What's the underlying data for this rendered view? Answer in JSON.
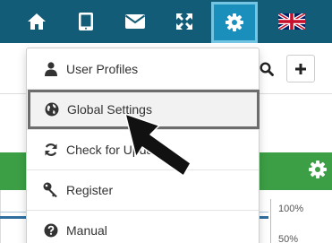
{
  "nav": {
    "buttons": [
      {
        "icon": "home-icon",
        "active": false
      },
      {
        "icon": "tablet-icon",
        "active": false
      },
      {
        "icon": "envelope-icon",
        "active": false
      },
      {
        "icon": "expand-arrows-icon",
        "active": false
      },
      {
        "icon": "gear-icon",
        "active": true
      },
      {
        "icon": "uk-flag-icon",
        "active": false
      }
    ],
    "active_color": "#1a8fbb",
    "bar_color": "#135c78"
  },
  "menu": {
    "items": [
      {
        "label": "User Profiles",
        "icon": "user-icon"
      },
      {
        "label": "Global Settings",
        "icon": "globe-icon",
        "highlighted": true
      },
      {
        "label": "Check for Upda",
        "icon": "refresh-icon"
      },
      {
        "label": "Register",
        "icon": "key-icon"
      },
      {
        "label": "Manual",
        "icon": "question-circle-icon"
      }
    ]
  },
  "widget": {
    "header_color": "#3c9f45",
    "axis_labels": [
      "100%",
      "50%"
    ]
  },
  "page": {
    "buttons": [
      {
        "icon": "search-icon"
      },
      {
        "icon": "plus-icon",
        "label": "+"
      }
    ]
  }
}
